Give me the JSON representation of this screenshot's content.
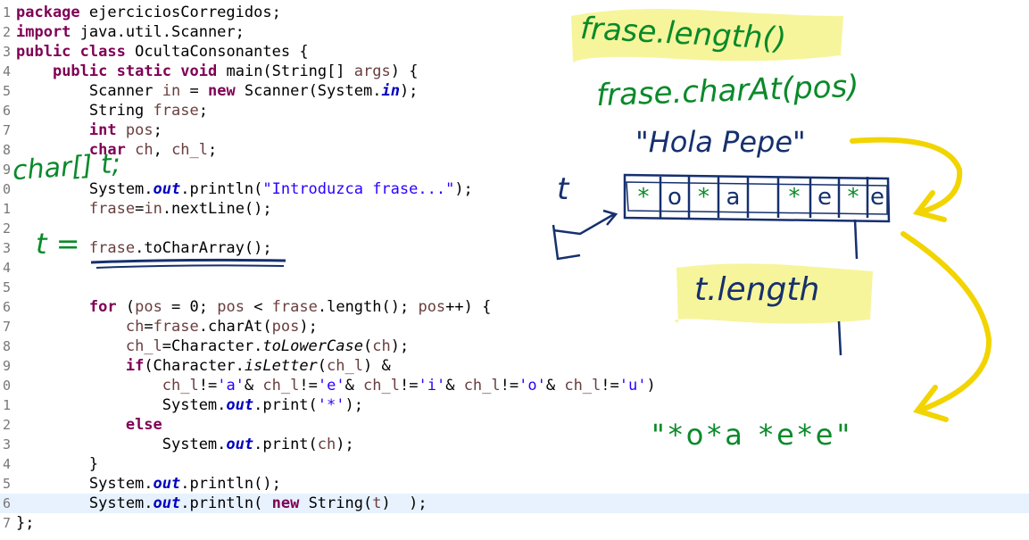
{
  "code_lines": [
    {
      "n": "1",
      "tokens": [
        [
          "kw",
          "package"
        ],
        [
          "p",
          " ejerciciosCorregidos;"
        ]
      ]
    },
    {
      "n": "2",
      "tokens": [
        [
          "kw",
          "import"
        ],
        [
          "p",
          " java.util.Scanner;"
        ]
      ]
    },
    {
      "n": "3",
      "tokens": [
        [
          "kw",
          "public"
        ],
        [
          "p",
          " "
        ],
        [
          "kw",
          "class"
        ],
        [
          "p",
          " OcultaConsonantes {"
        ]
      ]
    },
    {
      "n": "4",
      "tokens": [
        [
          "p",
          "    "
        ],
        [
          "kw",
          "public"
        ],
        [
          "p",
          " "
        ],
        [
          "kw",
          "static"
        ],
        [
          "p",
          " "
        ],
        [
          "kw",
          "void"
        ],
        [
          "p",
          " main(String[] "
        ],
        [
          "var",
          "args"
        ],
        [
          "p",
          ") {"
        ]
      ]
    },
    {
      "n": "5",
      "tokens": [
        [
          "p",
          "        Scanner "
        ],
        [
          "var",
          "in"
        ],
        [
          "p",
          " = "
        ],
        [
          "kw",
          "new"
        ],
        [
          "p",
          " Scanner(System."
        ],
        [
          "fld",
          "in"
        ],
        [
          "p",
          ");"
        ]
      ]
    },
    {
      "n": "6",
      "tokens": [
        [
          "p",
          "        String "
        ],
        [
          "var",
          "frase"
        ],
        [
          "p",
          ";"
        ]
      ]
    },
    {
      "n": "7",
      "tokens": [
        [
          "p",
          "        "
        ],
        [
          "kw",
          "int"
        ],
        [
          "p",
          " "
        ],
        [
          "var",
          "pos"
        ],
        [
          "p",
          ";"
        ]
      ]
    },
    {
      "n": "8",
      "tokens": [
        [
          "p",
          "        "
        ],
        [
          "kw",
          "char"
        ],
        [
          "p",
          " "
        ],
        [
          "var",
          "ch"
        ],
        [
          "p",
          ", "
        ],
        [
          "var",
          "ch_l"
        ],
        [
          "p",
          ";"
        ]
      ]
    },
    {
      "n": "9",
      "tokens": []
    },
    {
      "n": "0",
      "tokens": [
        [
          "p",
          "        System."
        ],
        [
          "fld",
          "out"
        ],
        [
          "p",
          ".println("
        ],
        [
          "str",
          "\"Introduzca frase...\""
        ],
        [
          "p",
          ");"
        ]
      ]
    },
    {
      "n": "1",
      "tokens": [
        [
          "p",
          "        "
        ],
        [
          "var",
          "frase"
        ],
        [
          "p",
          "="
        ],
        [
          "var",
          "in"
        ],
        [
          "p",
          ".nextLine();"
        ]
      ]
    },
    {
      "n": "2",
      "tokens": []
    },
    {
      "n": "3",
      "tokens": [
        [
          "p",
          "        "
        ],
        [
          "var",
          "frase"
        ],
        [
          "p",
          ".toCharArray();"
        ]
      ]
    },
    {
      "n": "4",
      "tokens": []
    },
    {
      "n": "5",
      "tokens": []
    },
    {
      "n": "6",
      "tokens": [
        [
          "p",
          "        "
        ],
        [
          "kw",
          "for"
        ],
        [
          "p",
          " ("
        ],
        [
          "var",
          "pos"
        ],
        [
          "p",
          " = 0; "
        ],
        [
          "var",
          "pos"
        ],
        [
          "p",
          " < "
        ],
        [
          "var",
          "frase"
        ],
        [
          "p",
          ".length(); "
        ],
        [
          "var",
          "pos"
        ],
        [
          "p",
          "++) {"
        ]
      ]
    },
    {
      "n": "7",
      "tokens": [
        [
          "p",
          "            "
        ],
        [
          "var",
          "ch"
        ],
        [
          "p",
          "="
        ],
        [
          "var",
          "frase"
        ],
        [
          "p",
          ".charAt("
        ],
        [
          "var",
          "pos"
        ],
        [
          "p",
          ");"
        ]
      ]
    },
    {
      "n": "8",
      "tokens": [
        [
          "p",
          "            "
        ],
        [
          "var",
          "ch_l"
        ],
        [
          "p",
          "=Character."
        ],
        [
          "sm",
          "toLowerCase"
        ],
        [
          "p",
          "("
        ],
        [
          "var",
          "ch"
        ],
        [
          "p",
          ");"
        ]
      ]
    },
    {
      "n": "9",
      "tokens": [
        [
          "p",
          "            "
        ],
        [
          "kw",
          "if"
        ],
        [
          "p",
          "(Character."
        ],
        [
          "sm",
          "isLetter"
        ],
        [
          "p",
          "("
        ],
        [
          "var",
          "ch_l"
        ],
        [
          "p",
          ") &"
        ]
      ]
    },
    {
      "n": "0",
      "tokens": [
        [
          "p",
          "                "
        ],
        [
          "var",
          "ch_l"
        ],
        [
          "p",
          "!="
        ],
        [
          "str",
          "'a'"
        ],
        [
          "p",
          "& "
        ],
        [
          "var",
          "ch_l"
        ],
        [
          "p",
          "!="
        ],
        [
          "str",
          "'e'"
        ],
        [
          "p",
          "& "
        ],
        [
          "var",
          "ch_l"
        ],
        [
          "p",
          "!="
        ],
        [
          "str",
          "'i'"
        ],
        [
          "p",
          "& "
        ],
        [
          "var",
          "ch_l"
        ],
        [
          "p",
          "!="
        ],
        [
          "str",
          "'o'"
        ],
        [
          "p",
          "& "
        ],
        [
          "var",
          "ch_l"
        ],
        [
          "p",
          "!="
        ],
        [
          "str",
          "'u'"
        ],
        [
          "p",
          ")"
        ]
      ]
    },
    {
      "n": "1",
      "tokens": [
        [
          "p",
          "                System."
        ],
        [
          "fld",
          "out"
        ],
        [
          "p",
          ".print("
        ],
        [
          "str",
          "'*'"
        ],
        [
          "p",
          ");"
        ]
      ]
    },
    {
      "n": "2",
      "tokens": [
        [
          "p",
          "            "
        ],
        [
          "kw",
          "else"
        ]
      ]
    },
    {
      "n": "3",
      "tokens": [
        [
          "p",
          "                System."
        ],
        [
          "fld",
          "out"
        ],
        [
          "p",
          ".print("
        ],
        [
          "var",
          "ch"
        ],
        [
          "p",
          ");"
        ]
      ]
    },
    {
      "n": "4",
      "tokens": [
        [
          "p",
          "        }"
        ]
      ]
    },
    {
      "n": "5",
      "tokens": [
        [
          "p",
          "        System."
        ],
        [
          "fld",
          "out"
        ],
        [
          "p",
          ".println();"
        ]
      ]
    },
    {
      "n": "6",
      "tokens": [
        [
          "p",
          "        System."
        ],
        [
          "fld",
          "out"
        ],
        [
          "p",
          ".println( "
        ],
        [
          "kw",
          "new"
        ],
        [
          "p",
          " String("
        ],
        [
          "var",
          "t"
        ],
        [
          "p",
          ")  );"
        ]
      ]
    },
    {
      "n": "7",
      "tokens": [
        [
          "p",
          "};"
        ]
      ]
    }
  ],
  "current_line_index": 25,
  "annotations": {
    "length_note": "frase.length()",
    "charat_note": "frase.charAt(pos)",
    "hola_pepe": "\"Hola Pepe\"",
    "char_array_decl": "char[] t;",
    "t_assign": "t =",
    "t_label": "t",
    "t_length": "t.length",
    "result": "\"*o*a *e*e\"",
    "cells": [
      "*",
      "o",
      "*",
      "a",
      " ",
      "*",
      "e",
      "*",
      "e"
    ]
  },
  "colors": {
    "keyword": "#7f0055",
    "variable": "#6a3e3e",
    "field": "#0000c0",
    "string": "#2a00ff",
    "ink_green": "#0a8a2a",
    "ink_blue": "#16306e",
    "highlight_yellow": "#f4f38a",
    "arrow_yellow": "#f2d400",
    "current_line": "#e8f2fe"
  }
}
